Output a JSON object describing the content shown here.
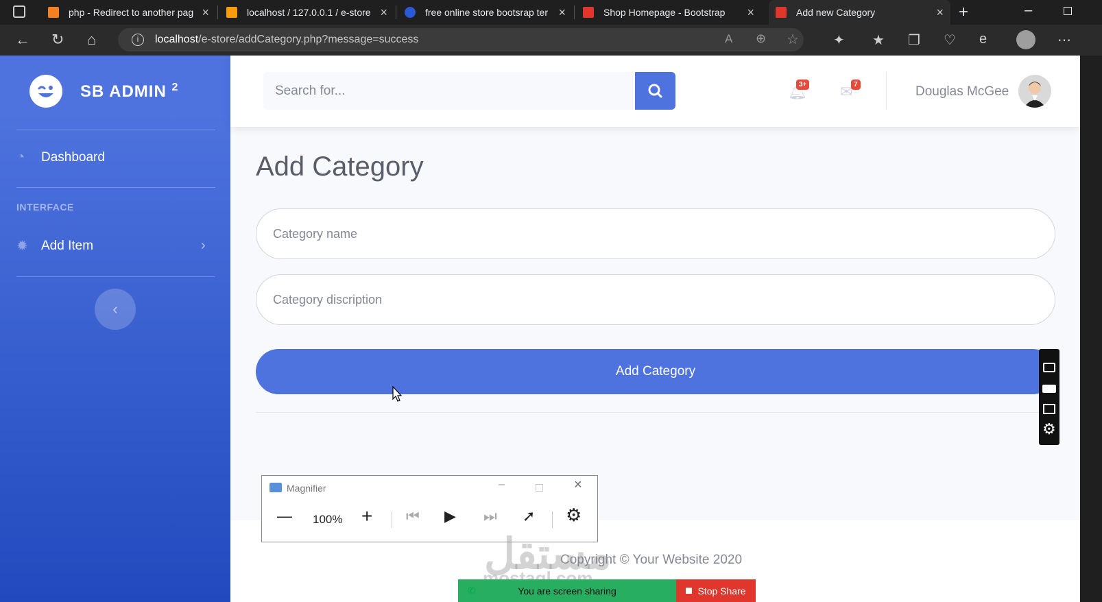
{
  "browser": {
    "tabs": [
      {
        "title": "php - Redirect to another pag",
        "icon": "stackoverflow-icon"
      },
      {
        "title": "localhost / 127.0.0.1 / e-store",
        "icon": "phpmyadmin-icon"
      },
      {
        "title": "free online store bootsrap ter",
        "icon": "search-icon"
      },
      {
        "title": "Shop Homepage - Bootstrap",
        "icon": "startbootstrap-icon"
      },
      {
        "title": "Add new Category",
        "icon": "startbootstrap-icon"
      }
    ],
    "url_host": "localhost",
    "url_path": "/e-store/addCategory.php?message=success"
  },
  "sidebar": {
    "brand": "SB ADMIN",
    "brand_sup": "2",
    "items": [
      {
        "label": "Dashboard",
        "icon": "tachometer-icon"
      },
      {
        "label": "Add Item",
        "icon": "cog-icon"
      }
    ],
    "heading": "INTERFACE"
  },
  "topbar": {
    "search_placeholder": "Search for...",
    "alerts_badge": "3+",
    "messages_badge": "7",
    "user_name": "Douglas McGee"
  },
  "main": {
    "title": "Add Category",
    "name_placeholder": "Category name",
    "description_placeholder": "Category discription",
    "submit_label": "Add Category"
  },
  "footer": {
    "copyright": "Copyright © Your Website 2020"
  },
  "magnifier": {
    "title": "Magnifier",
    "zoom": "100%"
  },
  "screenshare": {
    "status": "You are screen sharing",
    "stop_label": "Stop Share"
  },
  "watermark": {
    "arabic": "مستقل",
    "latin": "mostaql.com"
  },
  "colors": {
    "primary": "#4e73df",
    "danger": "#e74a3b",
    "share_green": "#27ae60"
  }
}
